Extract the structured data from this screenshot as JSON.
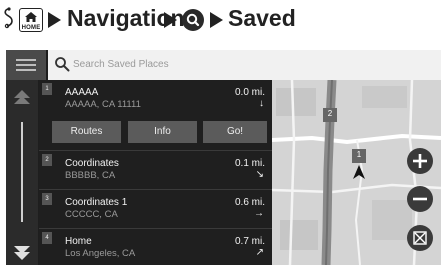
{
  "breadcrumb": {
    "home_label": "HOME",
    "navigation_label": "Navigation",
    "saved_label": "Saved"
  },
  "search": {
    "placeholder": "Search Saved Places"
  },
  "places": [
    {
      "index": "1",
      "name": "AAAAA",
      "address": "AAAAA, CA 11111",
      "distance": "0.0 mi.",
      "direction": "↓"
    },
    {
      "index": "2",
      "name": "Coordinates",
      "address": "BBBBB, CA",
      "distance": "0.1 mi.",
      "direction": "↘"
    },
    {
      "index": "3",
      "name": "Coordinates 1",
      "address": "CCCCC, CA",
      "distance": "0.6 mi.",
      "direction": "→"
    },
    {
      "index": "4",
      "name": "Home",
      "address": "Los Angeles, CA",
      "distance": "0.7 mi.",
      "direction": "↗"
    }
  ],
  "actions": {
    "routes_label": "Routes",
    "info_label": "Info",
    "go_label": "Go!"
  },
  "map": {
    "markers": [
      "1",
      "2"
    ]
  }
}
